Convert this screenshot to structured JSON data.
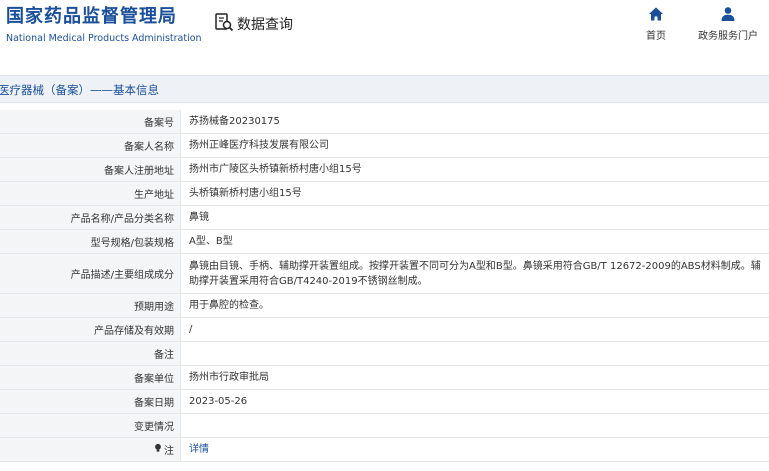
{
  "header": {
    "logo_cn": "国家药品监督管理局",
    "logo_en": "National Medical Products Administration",
    "query_label": "数据查询",
    "nav": [
      {
        "label": "首页",
        "icon": "home-icon"
      },
      {
        "label": "政务服务门户",
        "icon": "user-icon"
      }
    ],
    "brand_color": "#1a4f9c"
  },
  "section": {
    "title": "医疗器械（备案）——基本信息"
  },
  "rows": [
    {
      "label": "备案号",
      "value": "苏扬械备20230175"
    },
    {
      "label": "备案人名称",
      "value": "扬州正峰医疗科技发展有限公司"
    },
    {
      "label": "备案人注册地址",
      "value": "扬州市广陵区头桥镇新桥村唐小组15号"
    },
    {
      "label": "生产地址",
      "value": "头桥镇新桥村唐小组15号"
    },
    {
      "label": "产品名称/产品分类名称",
      "value": "鼻镜"
    },
    {
      "label": "型号规格/包装规格",
      "value": "A型、B型"
    },
    {
      "label": "产品描述/主要组成成分",
      "value": "鼻镜由目镜、手柄、辅助撑开装置组成。按撑开装置不同可分为A型和B型。鼻镜采用符合GB/T 12672-2009的ABS材料制成。辅助撑开装置采用符合GB/T4240-2019不锈钢丝制成。"
    },
    {
      "label": "预期用途",
      "value": "用于鼻腔的检查。"
    },
    {
      "label": "产品存储及有效期",
      "value": "/"
    },
    {
      "label": "备注",
      "value": ""
    },
    {
      "label": "备案单位",
      "value": "扬州市行政审批局"
    },
    {
      "label": "备案日期",
      "value": "2023-05-26"
    },
    {
      "label": "变更情况",
      "value": ""
    },
    {
      "label": "注",
      "value": "详情"
    }
  ]
}
